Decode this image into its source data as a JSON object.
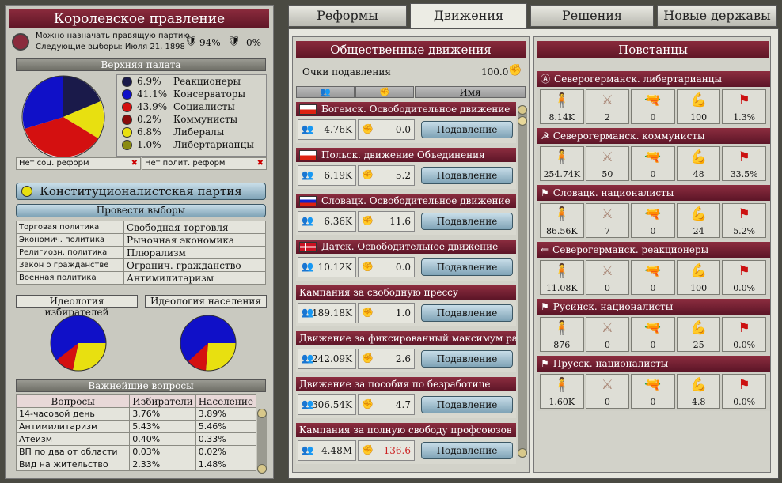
{
  "left": {
    "government_title": "Королевское правление",
    "party_line": "Можно назначать правящую партию",
    "elections_line": "Следующие выборы: Июля 21, 1898",
    "stat1": "94%",
    "stat2": "0%",
    "upper_house_title": "Верхняя палата",
    "upper_house": [
      {
        "pct": "6.9%",
        "name": "Реакционеры",
        "color": "#1a1a4a"
      },
      {
        "pct": "41.1%",
        "name": "Консерваторы",
        "color": "#1010c8"
      },
      {
        "pct": "43.9%",
        "name": "Социалисты",
        "color": "#d41010"
      },
      {
        "pct": "0.2%",
        "name": "Коммунисты",
        "color": "#8a0a0a"
      },
      {
        "pct": "6.8%",
        "name": "Либералы",
        "color": "#e8e010"
      },
      {
        "pct": "1.0%",
        "name": "Либертарианцы",
        "color": "#8a8a10"
      }
    ],
    "no_social_reform": "Нет соц. реформ",
    "no_political_reform": "Нет полит. реформ",
    "ruling_party": "Конституционалистская партия",
    "hold_elections": "Провести выборы",
    "policies": [
      {
        "k": "Торговая политика",
        "v": "Свободная торговля"
      },
      {
        "k": "Экономич. политика",
        "v": "Рыночная экономика"
      },
      {
        "k": "Религиозн. политика",
        "v": "Плюрализм"
      },
      {
        "k": "Закон о гражданстве",
        "v": "Огранич. гражданство"
      },
      {
        "k": "Военная политика",
        "v": "Антимилитаризм"
      }
    ],
    "voter_ideology": "Идеология избирателей",
    "pop_ideology": "Идеология населения",
    "issues_title": "Важнейшие вопросы",
    "issues_headers": [
      "Вопросы",
      "Избиратели",
      "Население"
    ],
    "issues": [
      [
        "14-часовой день",
        "3.76%",
        "3.89%"
      ],
      [
        "Антимилитаризм",
        "5.43%",
        "5.46%"
      ],
      [
        "Атеизм",
        "0.40%",
        "0.33%"
      ],
      [
        "ВП по два от области",
        "0.03%",
        "0.02%"
      ],
      [
        "Вид на жительство",
        "2.33%",
        "1.48%"
      ]
    ]
  },
  "tabs": [
    "Реформы",
    "Движения",
    "Решения",
    "Новые державы"
  ],
  "movements": {
    "title": "Общественные движения",
    "suppression_label": "Очки подавления",
    "suppression_value": "100.0",
    "name_header": "Имя",
    "suppress_label": "Подавление",
    "items": [
      {
        "name": "Богемск. Освободительное движение",
        "size": "4.76K",
        "radical": "0.0",
        "flag": "bohemia"
      },
      {
        "name": "Польск. движение Объединения",
        "size": "6.19K",
        "radical": "5.2",
        "flag": "poland"
      },
      {
        "name": "Словацк. Освободительное движение",
        "size": "6.36K",
        "radical": "11.6",
        "flag": "slovakia"
      },
      {
        "name": "Датск. Освободительное движение",
        "size": "10.12K",
        "radical": "0.0",
        "flag": "denmark"
      },
      {
        "name": "Кампания за свободную прессу",
        "size": "189.18K",
        "radical": "1.0",
        "flag": ""
      },
      {
        "name": "Движение за фиксированный максимум рабо ...",
        "size": "242.09K",
        "radical": "2.6",
        "flag": ""
      },
      {
        "name": "Движение за пособия по безработице",
        "size": "306.54K",
        "radical": "4.7",
        "flag": ""
      },
      {
        "name": "Кампания за полную свободу профсоюзов",
        "size": "4.48M",
        "radical": "136.6",
        "flag": "",
        "hot": true
      }
    ]
  },
  "rebels": {
    "title": "Повстанцы",
    "items": [
      {
        "name": "Северогерманск. либертарианцы",
        "sym": "Ⓐ",
        "vals": [
          "8.14K",
          "2",
          "0",
          "100",
          "1.3%"
        ]
      },
      {
        "name": "Северогерманск. коммунисты",
        "sym": "☭",
        "vals": [
          "254.74K",
          "50",
          "0",
          "48",
          "33.5%"
        ]
      },
      {
        "name": "Словацк. националисты",
        "sym": "⚑",
        "vals": [
          "86.56K",
          "7",
          "0",
          "24",
          "5.2%"
        ]
      },
      {
        "name": "Северогерманск. реакционеры",
        "sym": "⇐",
        "vals": [
          "11.08K",
          "0",
          "0",
          "100",
          "0.0%"
        ]
      },
      {
        "name": "Русинск. националисты",
        "sym": "⚑",
        "vals": [
          "876",
          "0",
          "0",
          "25",
          "0.0%"
        ]
      },
      {
        "name": "Прусск. националисты",
        "sym": "⚑",
        "vals": [
          "1.60K",
          "0",
          "0",
          "4.8",
          "0.0%"
        ]
      }
    ]
  }
}
